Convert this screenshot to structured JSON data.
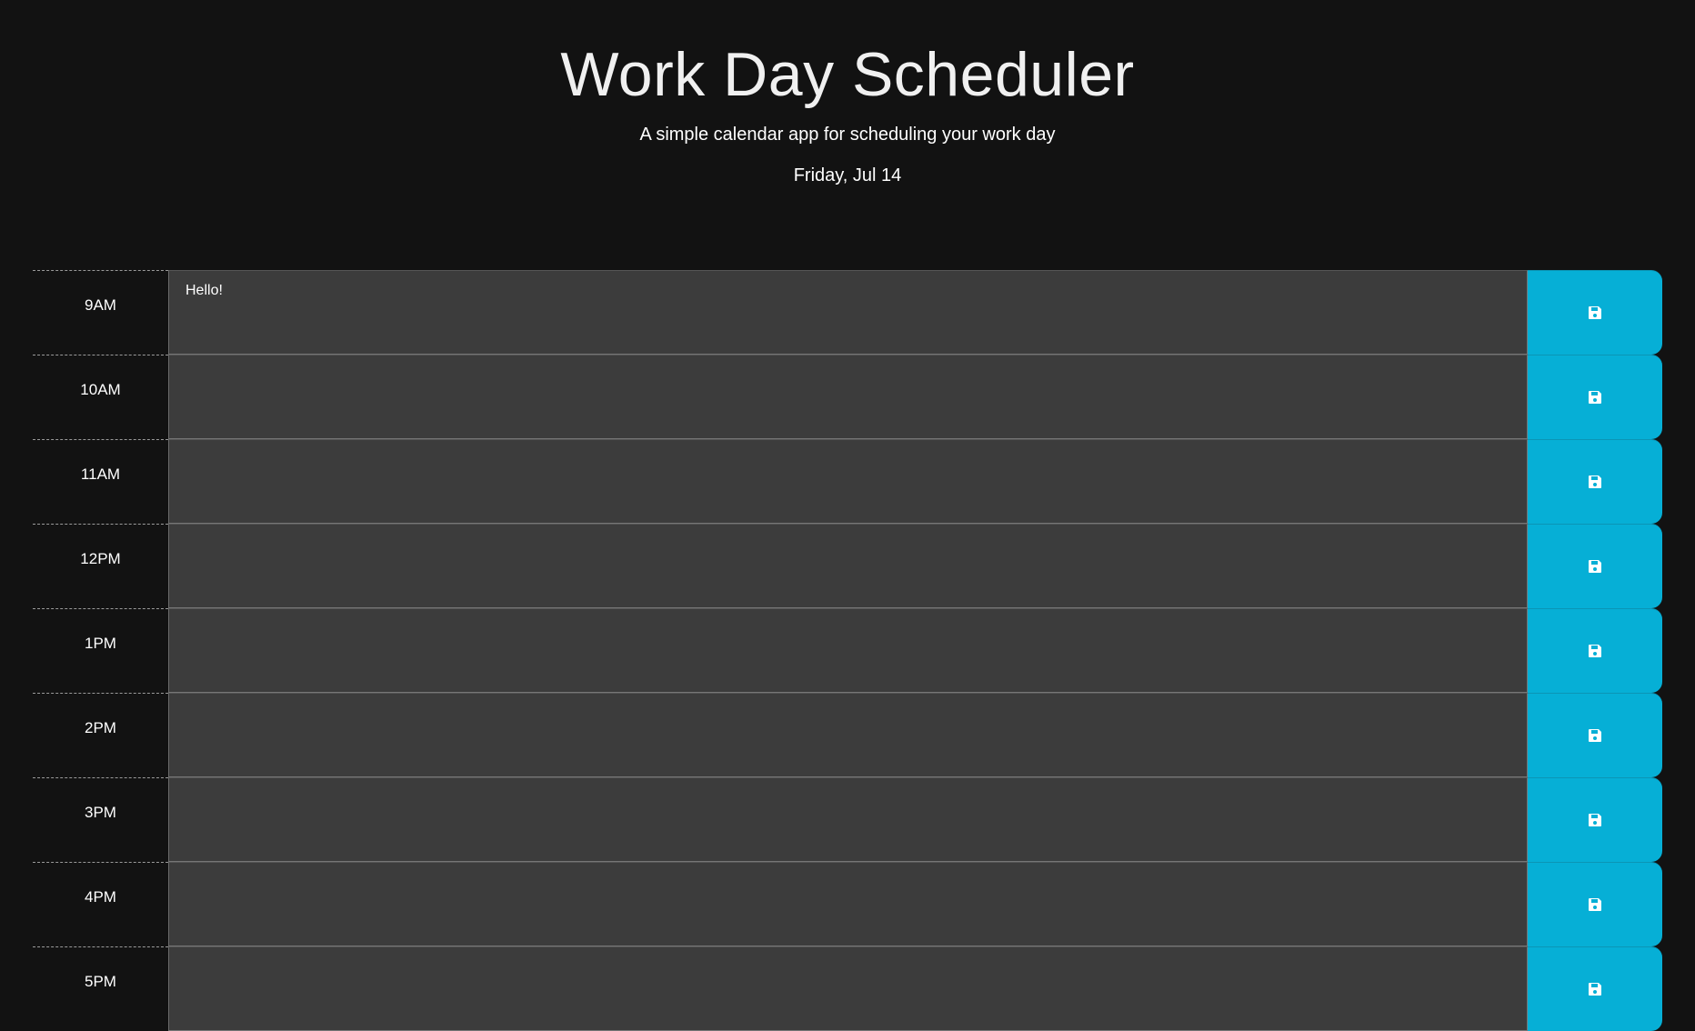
{
  "header": {
    "title": "Work Day Scheduler",
    "subtitle": "A simple calendar app for scheduling your work day",
    "date": "Friday, Jul 14"
  },
  "colors": {
    "background": "#121212",
    "row_fill": "#3c3c3c",
    "save_button": "#06afd6"
  },
  "rows": [
    {
      "hour": "9AM",
      "text": "Hello!"
    },
    {
      "hour": "10AM",
      "text": ""
    },
    {
      "hour": "11AM",
      "text": ""
    },
    {
      "hour": "12PM",
      "text": ""
    },
    {
      "hour": "1PM",
      "text": ""
    },
    {
      "hour": "2PM",
      "text": ""
    },
    {
      "hour": "3PM",
      "text": ""
    },
    {
      "hour": "4PM",
      "text": ""
    },
    {
      "hour": "5PM",
      "text": ""
    }
  ],
  "save_icon": "floppy-disk-icon"
}
